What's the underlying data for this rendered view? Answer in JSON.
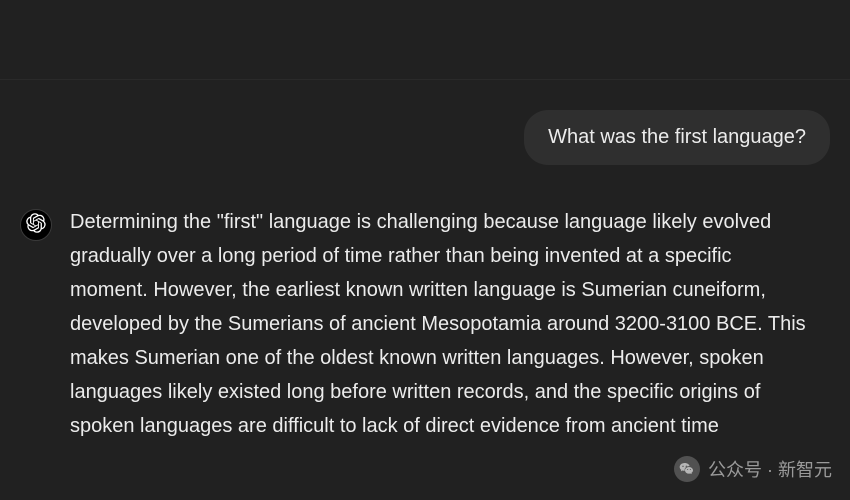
{
  "conversation": {
    "user_message": "What was the first language?",
    "assistant_message": "Determining the \"first\" language is challenging because language likely evolved gradually over a long period of time rather than being invented at a specific moment. However, the earliest known written language is Sumerian cuneiform, developed by the Sumerians of ancient Mesopotamia around 3200-3100 BCE. This makes Sumerian one of the oldest known written languages. However, spoken languages likely existed long before written records, and the specific origins of spoken languages are difficult to                                 lack of direct evidence from ancient time"
  },
  "watermark": {
    "label": "公众号 · 新智元"
  }
}
